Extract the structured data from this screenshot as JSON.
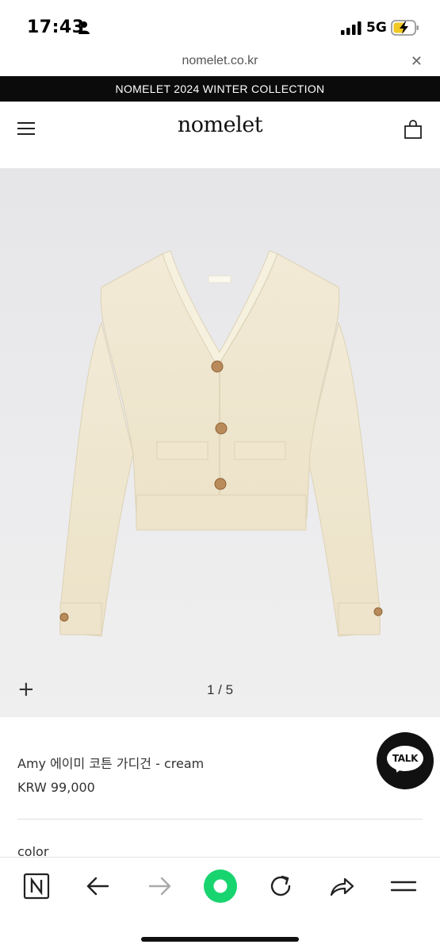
{
  "status_bar": {
    "time": "17:43",
    "network": "5G"
  },
  "browser": {
    "url": "nomelet.co.kr",
    "close_label": "✕"
  },
  "site": {
    "announcement": "NOMELET 2024 WINTER COLLECTION",
    "logo": "nomelet"
  },
  "gallery": {
    "zoom_label": "+",
    "counter": "1 / 5"
  },
  "product": {
    "name": "Amy 에이미 코튼 가디건 - cream",
    "price": "KRW 99,000",
    "option_label": "color"
  },
  "chat": {
    "label": "TALK"
  },
  "colors": {
    "accent_green": "#18d46f",
    "announce_bg": "#0b0b0b",
    "cardigan": "#efe6cf"
  },
  "toolbar_icons": [
    "naver-icon",
    "back-arrow-icon",
    "forward-arrow-icon",
    "green-dot-icon",
    "reload-icon",
    "share-icon",
    "menu-icon"
  ]
}
